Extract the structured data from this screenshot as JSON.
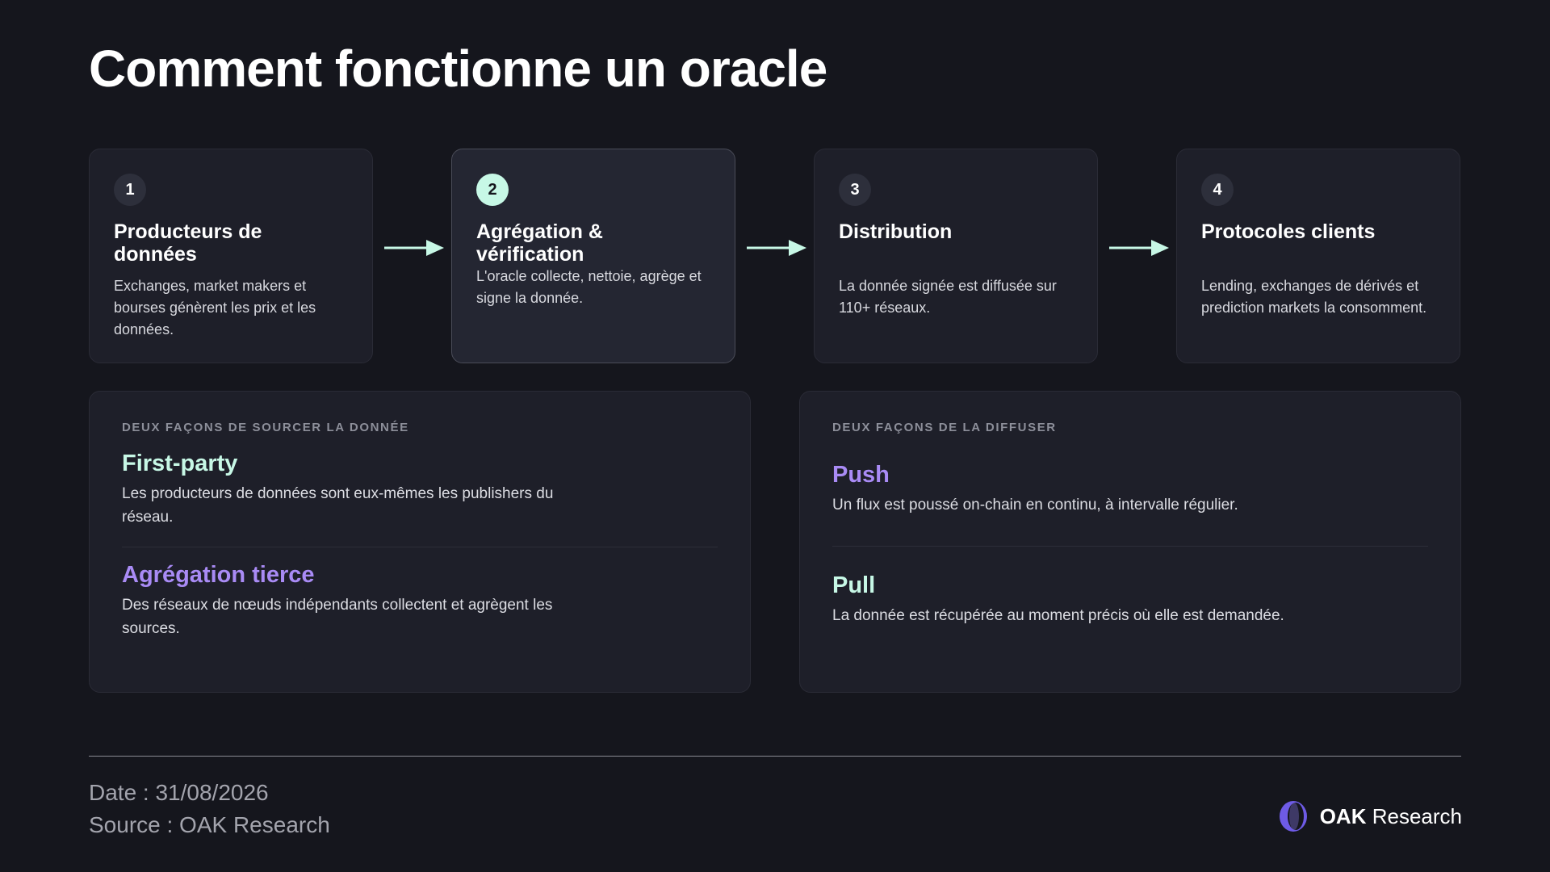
{
  "title": "Comment fonctionne un oracle",
  "colors": {
    "background": "#15161d",
    "card": "#1e1f29",
    "mint_accent": "#c7f8e6",
    "purple_accent": "#a98bf5"
  },
  "steps": [
    {
      "number": "1",
      "title": "Producteurs de données",
      "description": "Exchanges, market makers et bourses génèrent les prix et les données."
    },
    {
      "number": "2",
      "title": "Agrégation & vérification",
      "description": "L'oracle collecte, nettoie, agrège et signe la donnée.",
      "highlighted": true
    },
    {
      "number": "3",
      "title": "Distribution",
      "description": "La donnée signée est diffusée sur 110+ réseaux."
    },
    {
      "number": "4",
      "title": "Protocoles clients",
      "description": "Lending, exchanges de dérivés et prediction markets la consomment."
    }
  ],
  "sourcing": {
    "label": "DEUX FAÇONS DE SOURCER LA DONNÉE",
    "options": [
      {
        "title": "First-party",
        "description": "Les producteurs de données sont eux-mêmes les publishers du réseau.",
        "color": "#c7f8e6"
      },
      {
        "title": "Agrégation tierce",
        "description": "Des réseaux de nœuds indépendants collectent et agrègent les sources.",
        "color": "#a98bf5"
      }
    ]
  },
  "distribution": {
    "label": "DEUX FAÇONS DE LA DIFFUSER",
    "options": [
      {
        "title": "Push",
        "description": "Un flux est poussé on-chain en continu, à intervalle régulier.",
        "color": "#a98bf5"
      },
      {
        "title": "Pull",
        "description": "La donnée est récupérée au moment précis où elle est demandée.",
        "color": "#c7f8e6"
      }
    ]
  },
  "footer": {
    "date": "Date : 31/08/2026",
    "source": "Source : OAK Research",
    "brand_bold": "OAK",
    "brand_regular": "Research",
    "logo_icon": "oak-logo-icon"
  }
}
